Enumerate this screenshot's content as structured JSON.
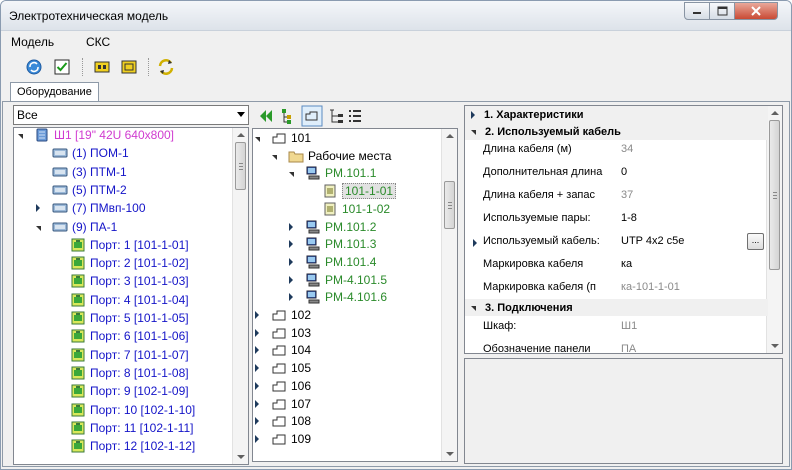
{
  "window": {
    "title": "Электротехническая модель"
  },
  "menu": [
    "Модель",
    "СКС"
  ],
  "toolbar": [
    {
      "icon": "refresh-icon"
    },
    {
      "icon": "check-icon"
    },
    {
      "icon": "device-icon"
    },
    {
      "icon": "panel-icon"
    },
    {
      "icon": "sync-icon"
    }
  ],
  "tabs": [
    {
      "label": "Оборудование"
    }
  ],
  "left": {
    "filter": "Все",
    "tree": [
      {
        "text": "Ш1 [19\" 42U 640x800]",
        "indent": 0,
        "expander": "open",
        "icon": "rack-icon",
        "color": "#d03cd0"
      },
      {
        "text": "(1) ПОМ-1",
        "indent": 1,
        "expander": "none",
        "icon": "panel-icon",
        "color": "#1414c8"
      },
      {
        "text": "(3) ПТМ-1",
        "indent": 1,
        "expander": "none",
        "icon": "panel-icon",
        "color": "#1414c8"
      },
      {
        "text": "(5) ПТМ-2",
        "indent": 1,
        "expander": "none",
        "icon": "panel-icon",
        "color": "#1414c8"
      },
      {
        "text": "(7) ПМвп-100",
        "indent": 1,
        "expander": "closed",
        "icon": "panel-icon",
        "color": "#1414c8"
      },
      {
        "text": "(9) ПА-1",
        "indent": 1,
        "expander": "open",
        "icon": "panel-icon",
        "color": "#1414c8"
      },
      {
        "text": "Порт: 1 [101-1-01]",
        "indent": 2,
        "expander": "none",
        "icon": "port-icon",
        "color": "#1414c8"
      },
      {
        "text": "Порт: 2 [101-1-02]",
        "indent": 2,
        "expander": "none",
        "icon": "port-icon",
        "color": "#1414c8"
      },
      {
        "text": "Порт: 3 [101-1-03]",
        "indent": 2,
        "expander": "none",
        "icon": "port-icon",
        "color": "#1414c8"
      },
      {
        "text": "Порт: 4 [101-1-04]",
        "indent": 2,
        "expander": "none",
        "icon": "port-icon",
        "color": "#1414c8"
      },
      {
        "text": "Порт: 5 [101-1-05]",
        "indent": 2,
        "expander": "none",
        "icon": "port-icon",
        "color": "#1414c8"
      },
      {
        "text": "Порт: 6 [101-1-06]",
        "indent": 2,
        "expander": "none",
        "icon": "port-icon",
        "color": "#1414c8"
      },
      {
        "text": "Порт: 7 [101-1-07]",
        "indent": 2,
        "expander": "none",
        "icon": "port-icon",
        "color": "#1414c8"
      },
      {
        "text": "Порт: 8 [101-1-08]",
        "indent": 2,
        "expander": "none",
        "icon": "port-icon",
        "color": "#1414c8"
      },
      {
        "text": "Порт: 9 [102-1-09]",
        "indent": 2,
        "expander": "none",
        "icon": "port-icon",
        "color": "#1414c8"
      },
      {
        "text": "Порт: 10 [102-1-10]",
        "indent": 2,
        "expander": "none",
        "icon": "port-icon",
        "color": "#1414c8"
      },
      {
        "text": "Порт: 11 [102-1-11]",
        "indent": 2,
        "expander": "none",
        "icon": "port-icon",
        "color": "#1414c8"
      },
      {
        "text": "Порт: 12 [102-1-12]",
        "indent": 2,
        "expander": "none",
        "icon": "port-icon",
        "color": "#1414c8"
      }
    ]
  },
  "middle": {
    "toolbar": [
      {
        "icon": "double-arrow-left-icon"
      },
      {
        "icon": "hierarchy-icon"
      },
      {
        "icon": "folder-view-icon"
      },
      {
        "icon": "tree-view-icon"
      },
      {
        "icon": "list-view-icon"
      }
    ],
    "tree": [
      {
        "text": "101",
        "indent": 0,
        "expander": "open",
        "icon": "room-icon",
        "color": "#000000"
      },
      {
        "text": "Рабочие места",
        "indent": 1,
        "expander": "open",
        "icon": "folder-icon",
        "color": "#000000"
      },
      {
        "text": "PM.101.1",
        "indent": 2,
        "expander": "open",
        "icon": "workstation-icon",
        "color": "#2a8a2a"
      },
      {
        "text": "101-1-01",
        "indent": 3,
        "expander": "none",
        "icon": "socket-icon",
        "color": "#2a8a2a",
        "selected": true
      },
      {
        "text": "101-1-02",
        "indent": 3,
        "expander": "none",
        "icon": "socket-icon",
        "color": "#2a8a2a"
      },
      {
        "text": "PM.101.2",
        "indent": 2,
        "expander": "closed",
        "icon": "workstation-icon",
        "color": "#2a8a2a"
      },
      {
        "text": "PM.101.3",
        "indent": 2,
        "expander": "closed",
        "icon": "workstation-icon",
        "color": "#2a8a2a"
      },
      {
        "text": "PM.101.4",
        "indent": 2,
        "expander": "closed",
        "icon": "workstation-icon",
        "color": "#2a8a2a"
      },
      {
        "text": "PM-4.101.5",
        "indent": 2,
        "expander": "closed",
        "icon": "workstation-icon",
        "color": "#2a8a2a"
      },
      {
        "text": "PM-4.101.6",
        "indent": 2,
        "expander": "closed",
        "icon": "workstation-icon",
        "color": "#2a8a2a"
      },
      {
        "text": "102",
        "indent": 0,
        "expander": "closed",
        "icon": "room-icon",
        "color": "#000000"
      },
      {
        "text": "103",
        "indent": 0,
        "expander": "closed",
        "icon": "room-icon",
        "color": "#000000"
      },
      {
        "text": "104",
        "indent": 0,
        "expander": "closed",
        "icon": "room-icon",
        "color": "#000000"
      },
      {
        "text": "105",
        "indent": 0,
        "expander": "closed",
        "icon": "room-icon",
        "color": "#000000"
      },
      {
        "text": "106",
        "indent": 0,
        "expander": "closed",
        "icon": "room-icon",
        "color": "#000000"
      },
      {
        "text": "107",
        "indent": 0,
        "expander": "closed",
        "icon": "room-icon",
        "color": "#000000"
      },
      {
        "text": "108",
        "indent": 0,
        "expander": "closed",
        "icon": "room-icon",
        "color": "#000000"
      },
      {
        "text": "109",
        "indent": 0,
        "expander": "closed",
        "icon": "room-icon",
        "color": "#000000"
      }
    ]
  },
  "properties": {
    "categories": [
      {
        "title": "1. Характеристики",
        "expanded": false,
        "rows": []
      },
      {
        "title": "2. Используемый кабель",
        "expanded": true,
        "rows": [
          {
            "name": "Длина кабеля (м)",
            "value": "34",
            "gray": true
          },
          {
            "name": "Дополнительная длина",
            "value": "0",
            "gray": false
          },
          {
            "name": "Длина кабеля + запас",
            "value": "37",
            "gray": true
          },
          {
            "name": "Используемые пары:",
            "value": "1-8",
            "gray": false
          },
          {
            "name": "Используемый кабель:",
            "value": "UTP 4x2 c5e",
            "gray": false,
            "expander": true,
            "button": "..."
          },
          {
            "name": "Маркировка кабеля",
            "value": "ка",
            "gray": false
          },
          {
            "name": "Маркировка кабеля (п",
            "value": "ка-101-1-01",
            "gray": true
          }
        ]
      },
      {
        "title": "3. Подключения",
        "expanded": true,
        "rows": [
          {
            "name": "Шкаф:",
            "value": "Ш1",
            "gray": true
          },
          {
            "name": "Обозначение панели",
            "value": "ПА",
            "gray": true
          }
        ]
      }
    ]
  }
}
